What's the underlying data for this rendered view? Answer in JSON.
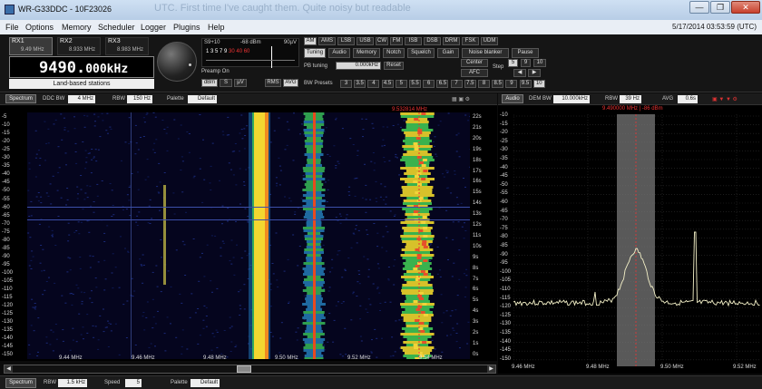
{
  "window": {
    "title": "WR-G33DDC - 10F23026",
    "ghost_overlay": "UTC. First time I've caught them. Quite noisy but readable",
    "minimize": "—",
    "maximize": "❐",
    "close": "✕"
  },
  "menu": {
    "items": [
      "File",
      "Options",
      "Memory",
      "Scheduler",
      "Logger",
      "Plugins",
      "Help"
    ],
    "timestamp": "5/17/2014 03:53:59 (UTC)"
  },
  "receiver": {
    "rx_tabs": [
      {
        "name": "RX1",
        "freq": "9.49 MHz"
      },
      {
        "name": "RX2",
        "freq": "8.933 MHz"
      },
      {
        "name": "RX3",
        "freq": "8.983 MHz"
      }
    ],
    "freq_main": "9490.",
    "freq_fine": "000kHz",
    "station": "Land-based stations"
  },
  "smeter": {
    "left": "S9+10",
    "center": "-68 dBm",
    "right": "90µV",
    "scale": "1  3  5 7 9  ",
    "scale_red": "30  40  60",
    "preamp": "Preamp On",
    "units": [
      "dBm",
      "S",
      "µV"
    ],
    "extras": [
      "RMS",
      "AVG"
    ]
  },
  "modes": [
    "AM",
    "AMS",
    "LSB",
    "USB",
    "CW",
    "FM",
    "ISB",
    "DSB",
    "DRM",
    "FSK",
    "UDM"
  ],
  "tuning_tabs": [
    "Tuning",
    "Audio",
    "Memory",
    "Notch",
    "Squelch",
    "Gain",
    "Noise blanker",
    "Pause"
  ],
  "tuning": {
    "pb_tuning_label": "PB tuning",
    "pb_value": "0.000kHz",
    "reset": "Reset",
    "center": "Center",
    "afc": "AFC",
    "step_label": "Step",
    "step_values": [
      "5",
      "9",
      "10"
    ],
    "step_arrows": [
      "◀",
      "▶"
    ],
    "step_sel": "10",
    "bw_label": "BW Presets",
    "bw_presets": [
      "3",
      "3.5",
      "4",
      "4.5",
      "5",
      "5.5",
      "6",
      "6.5",
      "7",
      "7.5",
      "8",
      "8.5",
      "9",
      "9.5",
      "10"
    ]
  },
  "spectrum_header": {
    "mode": "Spectrum",
    "ddc_label": "DDC BW",
    "ddc_value": "4 MHz",
    "rbw_label": "RBW",
    "rbw_value": "150 Hz",
    "palette_label": "Palette",
    "palette_value": "Default",
    "marker_freq": "9.532814 MHz"
  },
  "waterfall": {
    "y_labels": [
      "-5",
      "-10",
      "-15",
      "-20",
      "-25",
      "-30",
      "-35",
      "-40",
      "-45",
      "-50",
      "-55",
      "-60",
      "-65",
      "-70",
      "-75",
      "-80",
      "-85",
      "-90",
      "-95",
      "-100",
      "-105",
      "-110",
      "-115",
      "-120",
      "-125",
      "-130",
      "-135",
      "-140",
      "-145",
      "-150"
    ],
    "t_labels": [
      "22s",
      "21s",
      "20s",
      "19s",
      "18s",
      "17s",
      "16s",
      "15s",
      "14s",
      "13s",
      "12s",
      "11s",
      "10s",
      "9s",
      "8s",
      "7s",
      "6s",
      "5s",
      "4s",
      "3s",
      "2s",
      "1s",
      "0s"
    ],
    "x_labels": [
      "9.44 MHz",
      "9.46 MHz",
      "9.48 MHz",
      "9.50 MHz",
      "9.52 MHz",
      "9.54 MHz"
    ],
    "scroll_left": "◀",
    "scroll_right": "▶"
  },
  "audio_header": {
    "mode": "Audio",
    "dem_label": "DEM BW",
    "dem_value": "10.000kHz",
    "rbw_label": "RBW",
    "rbw_value": "39 Hz",
    "avg_label": "AVG",
    "avg_value": "0.6s",
    "marker": "9.490000 MHz | -86 dBm"
  },
  "audio_spectrum": {
    "y_labels": [
      "-10",
      "-15",
      "-20",
      "-25",
      "-30",
      "-35",
      "-40",
      "-45",
      "-50",
      "-55",
      "-60",
      "-65",
      "-70",
      "-75",
      "-80",
      "-85",
      "-90",
      "-95",
      "-100",
      "-105",
      "-110",
      "-115",
      "-120",
      "-125",
      "-130",
      "-135",
      "-140",
      "-145",
      "-150"
    ],
    "x_labels": [
      "9.46 MHz",
      "9.48 MHz",
      "9.50 MHz",
      "9.52 MHz"
    ]
  },
  "bottom_bar": {
    "mode": "Spectrum",
    "rbw_label": "RBW",
    "rbw_value": "1.5 kHz",
    "speed_label": "Speed",
    "speed_value": "5",
    "palette_label": "Palette",
    "palette_value": "Default"
  },
  "colors": {
    "accent_red": "#e33333",
    "trace": "#f4f1c8",
    "waterfall_bg": "#05051e"
  }
}
